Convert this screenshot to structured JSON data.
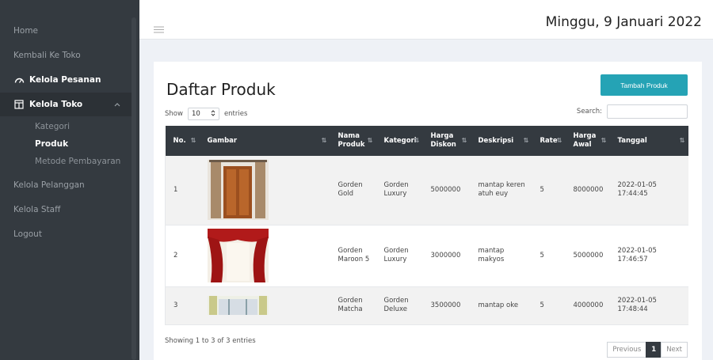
{
  "sidebar": {
    "items": [
      {
        "label": "Home"
      },
      {
        "label": "Kembali Ke Toko"
      },
      {
        "label": "Kelola Pesanan"
      },
      {
        "label": "Kelola Toko"
      },
      {
        "label": "Kelola Pelanggan"
      },
      {
        "label": "Kelola Staff"
      },
      {
        "label": "Logout"
      }
    ],
    "submenu": [
      {
        "label": "Kategori"
      },
      {
        "label": "Produk"
      },
      {
        "label": "Metode Pembayaran"
      }
    ]
  },
  "header": {
    "date": "Minggu, 9 Januari 2022"
  },
  "main": {
    "title": "Daftar Produk",
    "add_button": "Tambah Produk",
    "show_label": "Show",
    "entries_value": "10",
    "entries_label": "entries",
    "search_label": "Search:",
    "columns": [
      "No.",
      "Gambar",
      "Nama Produk",
      "Kategori",
      "Harga Diskon",
      "Deskripsi",
      "Rate",
      "Harga Awal",
      "Tanggal"
    ],
    "rows": [
      {
        "no": "1",
        "nama": "Gorden Gold",
        "kategori": "Gorden Luxury",
        "diskon": "5000000",
        "deskripsi": "mantap keren atuh euy",
        "rate": "5",
        "awal": "8000000",
        "tanggal": "2022-01-05 17:44:45"
      },
      {
        "no": "2",
        "nama": "Gorden Maroon 5",
        "kategori": "Gorden Luxury",
        "diskon": "3000000",
        "deskripsi": "mantap makyos",
        "rate": "5",
        "awal": "5000000",
        "tanggal": "2022-01-05 17:46:57"
      },
      {
        "no": "3",
        "nama": "Gorden Matcha",
        "kategori": "Gorden Deluxe",
        "diskon": "3500000",
        "deskripsi": "mantap oke",
        "rate": "5",
        "awal": "4000000",
        "tanggal": "2022-01-05 17:48:44"
      }
    ],
    "info": "Showing 1 to 3 of 3 entries",
    "pager": {
      "prev": "Previous",
      "current": "1",
      "next": "Next"
    }
  },
  "colors": {
    "sidebar": "#343a40",
    "accent": "#25a3b5",
    "table_header": "#343a40"
  }
}
